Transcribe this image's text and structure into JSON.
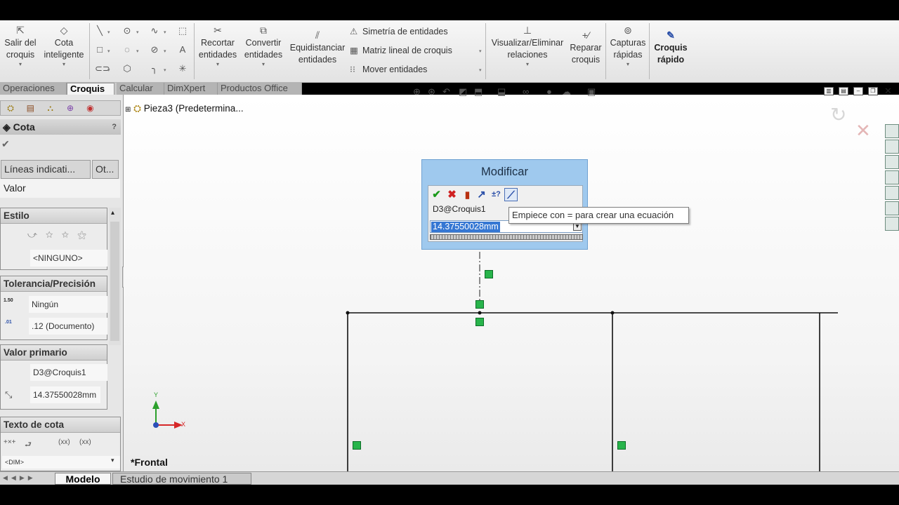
{
  "ribbon": {
    "salir_del_croquis": [
      "Salir del",
      "croquis"
    ],
    "cota_inteligente": [
      "Cota",
      "inteligente"
    ],
    "recortar_entidades": [
      "Recortar",
      "entidades"
    ],
    "convertir_entidades": [
      "Convertir",
      "entidades"
    ],
    "equidistanciar_entidades": [
      "Equidistanciar",
      "entidades"
    ],
    "simetria": "Simetría de entidades",
    "matriz": "Matriz lineal de croquis",
    "mover": "Mover entidades",
    "visualizar_relaciones": [
      "Visualizar/Eliminar",
      "relaciones"
    ],
    "reparar_croquis": [
      "Reparar",
      "croquis"
    ],
    "capturas_rapidas": [
      "Capturas",
      "rápidas"
    ],
    "croquis_rapido": [
      "Croquis",
      "rápido"
    ]
  },
  "tabs": [
    "Operaciones",
    "Croquis",
    "Calcular",
    "DimXpert",
    "Productos Office"
  ],
  "active_tab": "Croquis",
  "property_manager": {
    "title": "Cota",
    "help": "?",
    "subtabs": [
      "Líneas indicati...",
      "Ot..."
    ],
    "valor_tab": "Valor",
    "estilo": {
      "title": "Estilo",
      "style_value": "<NINGUNO>"
    },
    "tolerancia": {
      "title": "Tolerancia/Precisión",
      "tolerance": "Ningún",
      "precision": ".12 (Documento)",
      "tol_icon_label": "1.50",
      "prec_icon_label": ".01"
    },
    "valor_primario": {
      "title": "Valor primario",
      "name": "D3@Croquis1",
      "value": "14.37550028mm"
    },
    "texto_cota": {
      "title": "Texto de cota",
      "dim_field": "<DIM>",
      "paren1": "(xx)",
      "paren2": "(xx)"
    }
  },
  "tree": {
    "part": "Pieza3",
    "config": "(Predetermina..."
  },
  "modal": {
    "title": "Modificar",
    "reference": "D3@Croquis1",
    "value": "14.37550028mm"
  },
  "tooltip": "Empiece con = para crear una ecuación",
  "view_label": "*Frontal",
  "axes": {
    "y": "Y",
    "x": "X"
  },
  "bottom_tabs": [
    "Modelo",
    "Estudio de movimiento 1"
  ],
  "colors": {
    "accent_blue": "#3577d3",
    "modal_bg": "#9fc9ee",
    "constraint_green": "#28b44b"
  }
}
